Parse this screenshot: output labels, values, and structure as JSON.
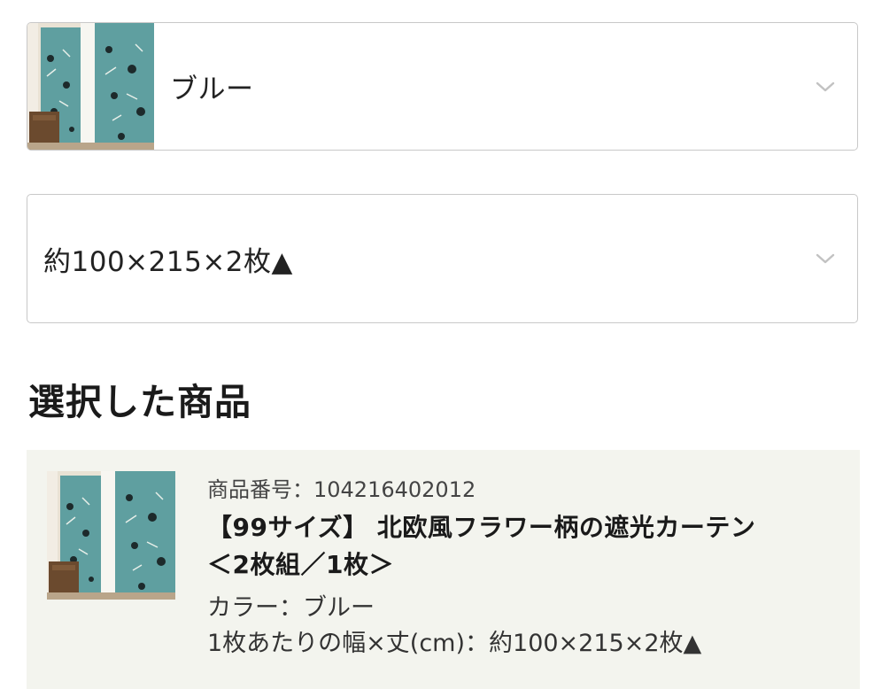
{
  "selectors": {
    "color": {
      "value": "ブルー"
    },
    "size": {
      "value": "約100×215×2枚▲"
    }
  },
  "section_title": "選択した商品",
  "selected_item": {
    "number_label": "商品番号：",
    "number": "104216402012",
    "name_line1": "【99サイズ】 北欧風フラワー柄の遮光カーテン",
    "name_line2": "＜2枚組／1枚＞",
    "color_label": "カラー：",
    "color_value": "ブルー",
    "size_label": "1枚あたりの幅×丈(cm)：",
    "size_value": "約100×215×2枚▲"
  },
  "colors": {
    "curtain": "#5f9fa0",
    "panel_bg": "#f3f4ee",
    "border": "#c8c8c8"
  },
  "icons": {
    "dropdown": "chevron-down-icon",
    "thumbnail": "curtain-product-image"
  }
}
